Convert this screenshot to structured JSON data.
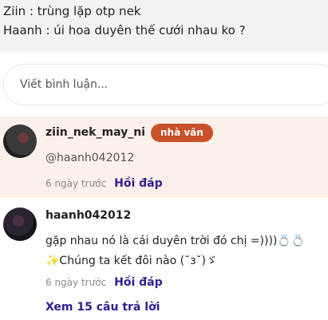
{
  "post": {
    "lines": [
      "Ziin : trùng lặp otp nek",
      "Haanh : úi hoa duyên thế cưới nhau ko ?"
    ]
  },
  "comment_box": {
    "placeholder": "Viết bình luận..."
  },
  "comments": [
    {
      "username": "ziin_nek_may_ni",
      "badge": "nhà văn",
      "text_lines": [
        "@haanh042012"
      ],
      "time": "6 ngày trước",
      "reply_label": "Hồi đáp"
    },
    {
      "username": "haanh042012",
      "text_lines": [
        "gặp nhau nó là cái duyên trời đó chị =))))💍💍",
        "✨Chúng ta kết đôi nào (˘з˘)ゞ"
      ],
      "time": "6 ngày trước",
      "reply_label": "Hồi đáp",
      "view_replies": "Xem 15 câu trả lời"
    }
  ]
}
